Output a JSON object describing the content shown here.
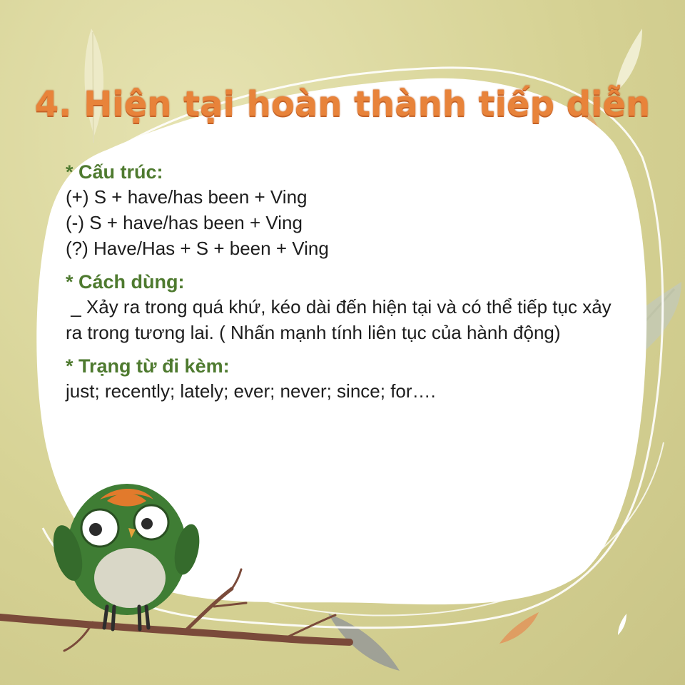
{
  "title": "4. Hiện tại hoàn thành tiếp diễn",
  "structure": {
    "heading": "* Cấu trúc:",
    "lines": [
      "(+) S + have/has been + Ving",
      "(-) S + have/has been + Ving",
      "(?) Have/Has + S + been + Ving"
    ]
  },
  "usage": {
    "heading": "* Cách dùng:",
    "lines": [
      " _ Xảy ra trong quá khứ, kéo dài đến hiện tại và có thể tiếp tục xảy",
      "ra trong tương lai. ( Nhấn mạnh tính liên tục của hành động)"
    ]
  },
  "adverbs": {
    "heading": "* Trạng từ đi kèm:",
    "lines": [
      "just; recently; lately; ever; never; since; for…."
    ]
  },
  "colors": {
    "title": "#e8833a",
    "heading": "#4e7a2f",
    "background": "#d8d49a",
    "panel": "#ffffff"
  }
}
